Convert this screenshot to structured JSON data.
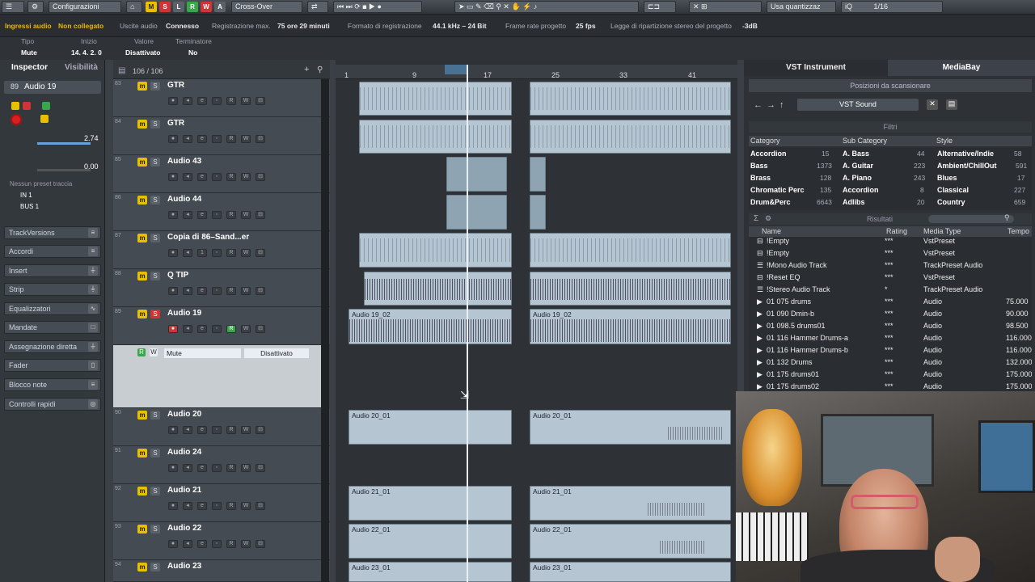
{
  "toolbar": {
    "config_label": "Configurazioni",
    "mode_buttons": [
      "M",
      "S",
      "L",
      "R",
      "W",
      "A"
    ],
    "crossover_label": "Cross-Over",
    "quantize_label": "Usa quantizzaz",
    "quantize_value": "1/16",
    "iq_label": "iQ"
  },
  "status": {
    "audio_inputs": "Ingressi audio",
    "audio_inputs_state": "Non collegato",
    "audio_outputs": "Uscite audio",
    "audio_outputs_state": "Connesso",
    "rec_max": "Registrazione max.",
    "rec_max_value": "75 ore 29 minuti",
    "rec_format": "Formato di registrazione",
    "rec_format_value": "44.1 kHz – 24 Bit",
    "frame_rate": "Frame rate progetto",
    "frame_rate_value": "25 fps",
    "pan_law": "Legge di ripartizione stereo del progetto",
    "pan_law_value": "-3dB"
  },
  "infoline": {
    "headers": [
      "Tipo",
      "Inizio",
      "Valore",
      "Terminatore"
    ],
    "values": [
      "Mute",
      "14. 4. 2.   0",
      "Disattivato",
      "No"
    ]
  },
  "inspector": {
    "tab_inspector": "Inspector",
    "tab_visibility": "Visibilità",
    "track_number": "89",
    "track_name": "Audio 19",
    "volume_value": "2.74",
    "pan_value": "0.00",
    "preset": "Nessun preset traccia",
    "input": "IN 1",
    "output": "BUS 1",
    "sections": [
      "TrackVersions",
      "Accordi",
      "Insert",
      "Strip",
      "Equalizzatori",
      "Mandate",
      "Assegnazione diretta",
      "Fader",
      "Blocco note",
      "Controlli rapidi"
    ]
  },
  "tracklist": {
    "count": "106 / 106",
    "tracks": [
      {
        "num": "83",
        "name": "GTR"
      },
      {
        "num": "84",
        "name": "GTR"
      },
      {
        "num": "85",
        "name": "Audio 43"
      },
      {
        "num": "86",
        "name": "Audio 44"
      },
      {
        "num": "87",
        "name": "Copia di  86–Sand...er"
      },
      {
        "num": "88",
        "name": "Q TIP"
      },
      {
        "num": "89",
        "name": "Audio 19"
      },
      {
        "num": "90",
        "name": "Audio 20"
      },
      {
        "num": "91",
        "name": "Audio 24"
      },
      {
        "num": "92",
        "name": "Audio 21"
      },
      {
        "num": "93",
        "name": "Audio 22"
      },
      {
        "num": "94",
        "name": "Audio 23"
      }
    ],
    "automation_param": "Mute",
    "automation_value": "Disattivato"
  },
  "ruler": {
    "bars": [
      "1",
      "9",
      "17",
      "25",
      "33",
      "41"
    ]
  },
  "clips": {
    "audio19a": "Audio 19_02",
    "audio19b": "Audio 19_02",
    "audio20a": "Audio 20_01",
    "audio20b": "Audio 20_01",
    "audio21a": "Audio 21_01",
    "audio21b": "Audio 21_01",
    "audio22a": "Audio 22_01",
    "audio22b": "Audio 22_01",
    "audio23a": "Audio 23_01",
    "audio23b": "Audio 23_01"
  },
  "mediabay": {
    "tab_vst": "VST Instrument",
    "tab_mediabay": "MediaBay",
    "scan_locations": "Posizioni da scansionare",
    "location": "VST Sound",
    "filters": "Filtri",
    "cat_header": "Category",
    "subcat_header": "Sub Category",
    "style_header": "Style",
    "categories": [
      [
        "Accordion",
        "15"
      ],
      [
        "Bass",
        "1373"
      ],
      [
        "Brass",
        "128"
      ],
      [
        "Chromatic Perc",
        "135"
      ],
      [
        "Drum&Perc",
        "6643"
      ]
    ],
    "subcategories": [
      [
        "A. Bass",
        "44"
      ],
      [
        "A. Guitar",
        "223"
      ],
      [
        "A. Piano",
        "243"
      ],
      [
        "Accordion",
        "8"
      ],
      [
        "Adlibs",
        "20"
      ]
    ],
    "styles": [
      [
        "Alternative/Indie",
        "58"
      ],
      [
        "Ambient/ChillOut",
        "591"
      ],
      [
        "Blues",
        "17"
      ],
      [
        "Classical",
        "227"
      ],
      [
        "Country",
        "659"
      ]
    ],
    "results": "Risultati",
    "res_headers": [
      "Name",
      "Rating",
      "Media Type",
      "Tempo"
    ],
    "rows": [
      {
        "name": "!Empty",
        "rating": "***",
        "type": "VstPreset",
        "tempo": ""
      },
      {
        "name": "!Empty",
        "rating": "***",
        "type": "VstPreset",
        "tempo": ""
      },
      {
        "name": "!Mono Audio Track",
        "rating": "***",
        "type": "TrackPreset Audio",
        "tempo": ""
      },
      {
        "name": "!Reset EQ",
        "rating": "***",
        "type": "VstPreset",
        "tempo": ""
      },
      {
        "name": "!Stereo Audio Track",
        "rating": "*",
        "type": "TrackPreset Audio",
        "tempo": ""
      },
      {
        "name": "01 075 drums",
        "rating": "***",
        "type": "Audio",
        "tempo": "75.000"
      },
      {
        "name": "01 090 Dmin-b",
        "rating": "***",
        "type": "Audio",
        "tempo": "90.000"
      },
      {
        "name": "01 098.5 drums01",
        "rating": "***",
        "type": "Audio",
        "tempo": "98.500"
      },
      {
        "name": "01 116 Hammer Drums-a",
        "rating": "***",
        "type": "Audio",
        "tempo": "116.000"
      },
      {
        "name": "01 116 Hammer Drums-b",
        "rating": "***",
        "type": "Audio",
        "tempo": "116.000"
      },
      {
        "name": "01 132 Drums",
        "rating": "***",
        "type": "Audio",
        "tempo": "132.000"
      },
      {
        "name": "01 175 drums01",
        "rating": "***",
        "type": "Audio",
        "tempo": "175.000"
      },
      {
        "name": "01 175 drums02",
        "rating": "***",
        "type": "Audio",
        "tempo": "175.000"
      }
    ]
  },
  "colors": {
    "accent": "#e8c000",
    "record": "#d03535",
    "loop": "#4d7ea8"
  }
}
